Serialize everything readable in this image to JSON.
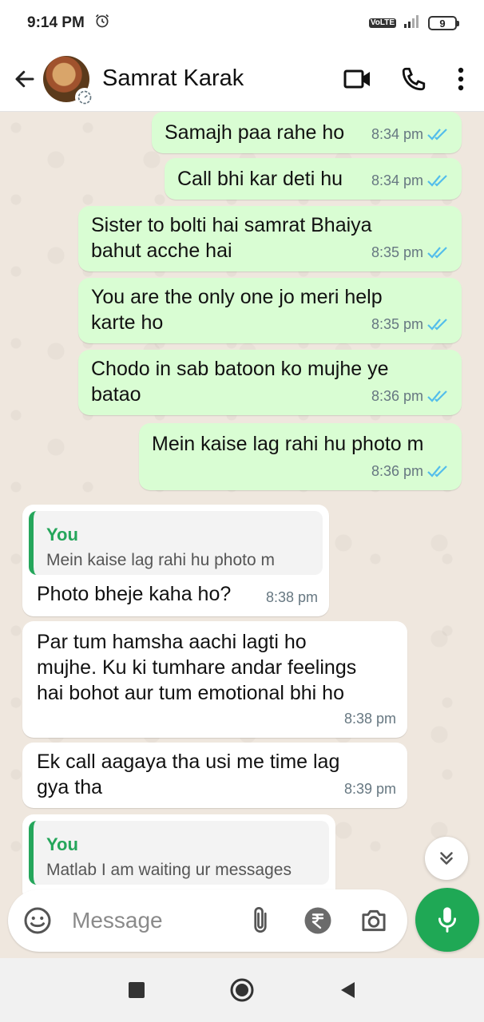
{
  "status_bar": {
    "time": "9:14 PM",
    "battery": "9",
    "network": "VoLTE"
  },
  "header": {
    "contact_name": "Samrat Karak"
  },
  "messages": [
    {
      "dir": "out",
      "text_lines": [
        "Samajh paa rahe ho"
      ],
      "time": "8:34 pm"
    },
    {
      "dir": "out",
      "text_lines": [
        "Call bhi kar deti hu"
      ],
      "time": "8:34 pm"
    },
    {
      "dir": "out",
      "text_lines": [
        "Sister to bolti hai samrat Bhaiya",
        "bahut acche hai"
      ],
      "time": "8:35 pm"
    },
    {
      "dir": "out",
      "text_lines": [
        "You are the only one jo meri help",
        "karte ho"
      ],
      "time": "8:35 pm"
    },
    {
      "dir": "out",
      "text_lines": [
        "Chodo in sab batoon ko mujhe ye",
        "batao"
      ],
      "time": "8:36 pm"
    },
    {
      "dir": "out",
      "text_lines": [
        "Mein kaise lag rahi hu photo m"
      ],
      "time": "8:36 pm"
    },
    {
      "dir": "in",
      "quote_author": "You",
      "quote_text": "Mein kaise lag rahi hu photo m",
      "text_lines": [
        "Photo bheje kaha ho?"
      ],
      "time": "8:38 pm"
    },
    {
      "dir": "in",
      "text_lines": [
        "Par tum hamsha aachi lagti ho",
        "mujhe.  Ku ki tumhare andar feelings",
        "hai bohot aur tum emotional bhi ho"
      ],
      "time": "8:38 pm"
    },
    {
      "dir": "in",
      "text_lines": [
        "Ek call aagaya tha usi me time lag",
        "gya tha"
      ],
      "time": "8:39 pm"
    },
    {
      "dir": "in",
      "quote_author": "You",
      "quote_text": "Matlab I am waiting ur messages",
      "text_lines": [],
      "time": ""
    }
  ],
  "input": {
    "placeholder": "Message"
  },
  "colors": {
    "outgoing": "#d9fdd3",
    "incoming": "#ffffff",
    "accent": "#1fa855",
    "ticks": "#53bdeb"
  }
}
